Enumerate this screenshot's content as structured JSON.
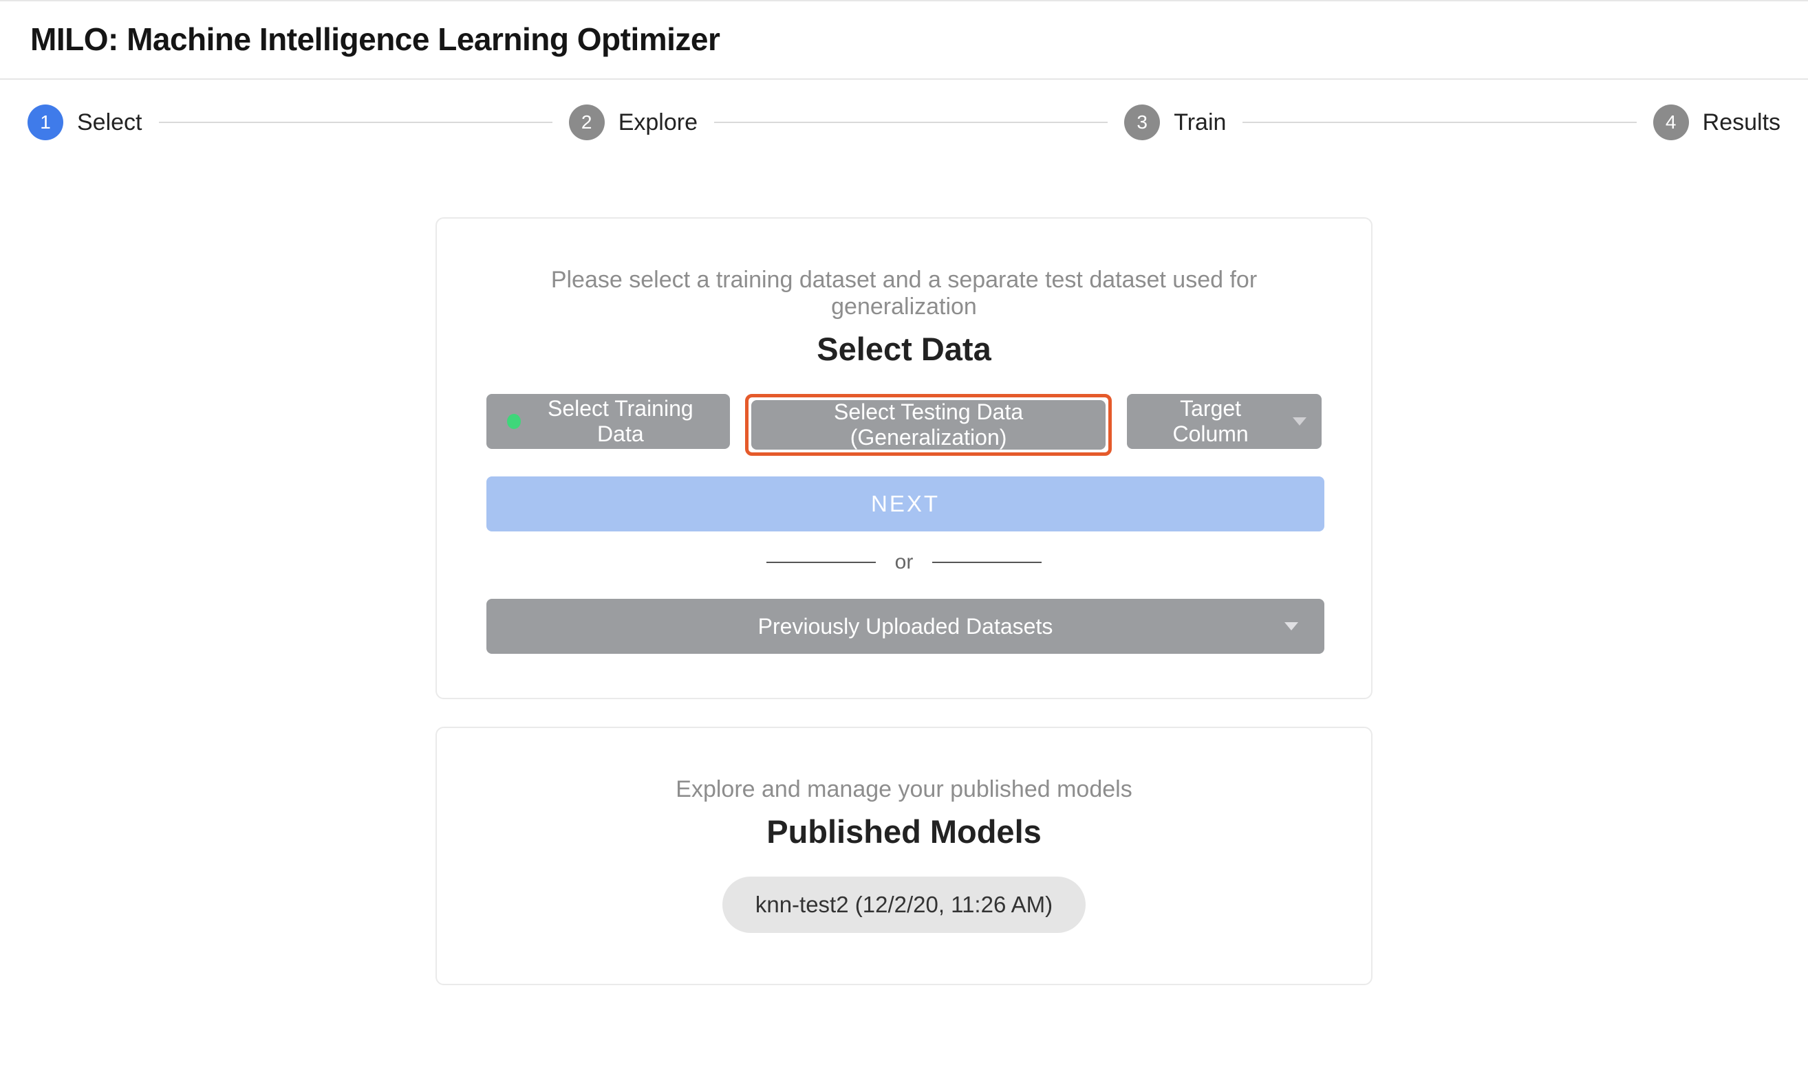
{
  "header": {
    "title": "MILO: Machine Intelligence Learning Optimizer"
  },
  "stepper": {
    "steps": [
      {
        "num": "1",
        "label": "Select",
        "active": true
      },
      {
        "num": "2",
        "label": "Explore",
        "active": false
      },
      {
        "num": "3",
        "label": "Train",
        "active": false
      },
      {
        "num": "4",
        "label": "Results",
        "active": false
      }
    ]
  },
  "select_card": {
    "instruction": "Please select a training dataset and a separate test dataset used for generalization",
    "heading": "Select Data",
    "training_btn": "Select Training Data",
    "testing_btn": "Select Testing Data (Generalization)",
    "target_btn": "Target Column",
    "next_btn": "NEXT",
    "or_text": "or",
    "prev_uploaded": "Previously Uploaded Datasets"
  },
  "models_card": {
    "instruction": "Explore and manage your published models",
    "heading": "Published Models",
    "items": [
      "knn-test2 (12/2/20, 11:26 AM)"
    ]
  }
}
